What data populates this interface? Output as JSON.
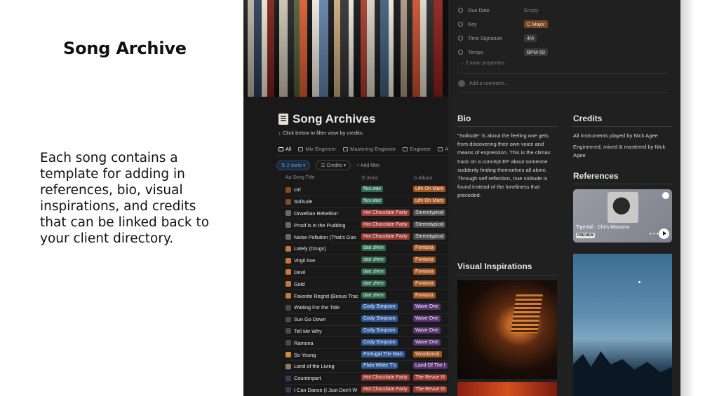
{
  "slide": {
    "title": "Song Archive",
    "description": "Each song contains a template for adding in references, bio, visual inspirations, and credits that can be linked back to your client directory."
  },
  "cover": {
    "spine_colors": [
      "#1a1a1a",
      "#b9b1a2",
      "#2a3b57",
      "#e9e2d0",
      "#7a1e18",
      "#0f0f0f",
      "#c9c2b2",
      "#222",
      "#4d5b3a",
      "#d85a2e",
      "#0b0b0b",
      "#ece7db",
      "#5f7fa6",
      "#141414",
      "#caa87a",
      "#2f2f2f",
      "#eae6dd",
      "#131313",
      "#a63a2b",
      "#d7d2c4",
      "#1c1c1c",
      "#3e5c7a",
      "#efe9da",
      "#101010",
      "#a89480",
      "#1e1e1e",
      "#c64d2f",
      "#dcd7ca",
      "#262626",
      "#8b1d1a"
    ]
  },
  "database": {
    "title": "Song Archives",
    "subtitle": "↓ Click below to filter view by credits.",
    "views": [
      "All",
      "Mix Engineer",
      "Mastering Engineer",
      "Engineer",
      "As"
    ],
    "sort_label": "⇅ 2 sorts ▾",
    "credits_filter": "☰ Credits ▾",
    "add_filter": "+ Add filter",
    "columns": {
      "title": "Aa Song Title",
      "artist": "☰ Artist",
      "album": "⊙ Album"
    },
    "rows": [
      {
        "title": "ctrl",
        "artist": "flux.wav",
        "album": "Life On Mars"
      },
      {
        "title": "Solitude",
        "artist": "flux.wav",
        "album": "Life On Mars"
      },
      {
        "title": "Orwellian Rebellion",
        "artist": "Hot Chocolate Party",
        "album": "Stereotypical"
      },
      {
        "title": "Proof is in the Pudding",
        "artist": "Hot Chocolate Party",
        "album": "Stereotypical"
      },
      {
        "title": "Noise Pollution (That's Goo",
        "artist": "Hot Chocolate Party",
        "album": "Stereotypical"
      },
      {
        "title": "Lately (Drugs)",
        "artist": "dae zhen",
        "album": "Fontana"
      },
      {
        "title": "Virgil Ave.",
        "artist": "dae zhen",
        "album": "Fontana"
      },
      {
        "title": "Devil",
        "artist": "dae zhen",
        "album": "Fontana"
      },
      {
        "title": "Gold",
        "artist": "dae zhen",
        "album": "Fontana"
      },
      {
        "title": "Favorite Regret (Bonus Trac",
        "artist": "dae zhen",
        "album": "Fontana"
      },
      {
        "title": "Waiting For the Tide",
        "artist": "Cody Simpson",
        "album": "Wave One"
      },
      {
        "title": "Sun Go Down",
        "artist": "Cody Simpson",
        "album": "Wave One"
      },
      {
        "title": "Tell Me Why",
        "artist": "Cody Simpson",
        "album": "Wave One"
      },
      {
        "title": "Ramona",
        "artist": "Cody Simpson",
        "album": "Wave One"
      },
      {
        "title": "So Young",
        "artist": "Portugal.The Man",
        "album": "Woodstock"
      },
      {
        "title": "Land of the Living",
        "artist": "Plain White T's",
        "album": "Land Of The I"
      },
      {
        "title": "Counterpart",
        "artist": "Hot Chocolate Party",
        "album": "The Revue III"
      },
      {
        "title": "I Can Dance (I Just Don't W",
        "artist": "Hot Chocolate Party",
        "album": "The Revue III"
      }
    ]
  },
  "colors": {
    "flux.wav": "#2d6a4f",
    "Hot Chocolate Party": "#9b3a30",
    "dae zhen": "#2d6a4f",
    "Cody Simpson": "#2f5a9a",
    "Portugal.The Man": "#2f5a9a",
    "Plain White T's": "#2f5a9a",
    "Life On Mars": "#a4541f",
    "Stereotypical": "#4a4a4a",
    "Fontana": "#a4541f",
    "Wave One": "#5b3575",
    "Woodstock": "#a4541f",
    "Land Of The I": "#5b3575",
    "The Revue III": "#9b3a30"
  },
  "row_icon_colors": [
    "#8a4a1f",
    "#8a4a1f",
    "#6a6a6a",
    "#6a6a6a",
    "#6a6a6a",
    "#c7773a",
    "#c7773a",
    "#c7773a",
    "#c7773a",
    "#c7773a",
    "#4a4a4a",
    "#4a4a4a",
    "#4a4a4a",
    "#4a4a4a",
    "#d08a3a",
    "#8a7a6a",
    "#3a3a5a",
    "#3a3a5a"
  ],
  "properties": [
    {
      "label": "Due Date",
      "value": "Empty",
      "style": "empty"
    },
    {
      "label": "Key",
      "value": "C Major",
      "style": "key"
    },
    {
      "label": "Time Signature",
      "value": "4/4",
      "style": "box"
    },
    {
      "label": "Tempo",
      "value": "BPM 69",
      "style": "box"
    }
  ],
  "more_properties": "⌄ 2 more properties",
  "comment_placeholder": "Add a comment...",
  "bio": {
    "heading": "Bio",
    "text": "\"Solitude\" is about the feeling one gets from discovering their own voice and means of expression. This is the climax track on a concept EP about someone suddenly finding themselves all alone. Through self reflection, true solitude is found instead of the loneliness that preceded."
  },
  "credits": {
    "heading": "Credits",
    "lines": [
      "All instruments played by Nick Agee",
      "Engineered, mixed & mastered by Nick Agee"
    ]
  },
  "references": {
    "heading": "References",
    "track": "Tigertail · Chris Mazuera",
    "badge": "PREVIEW",
    "more": "• • •"
  },
  "visual_inspirations": {
    "heading": "Visual Inspirations"
  },
  "help": "?"
}
